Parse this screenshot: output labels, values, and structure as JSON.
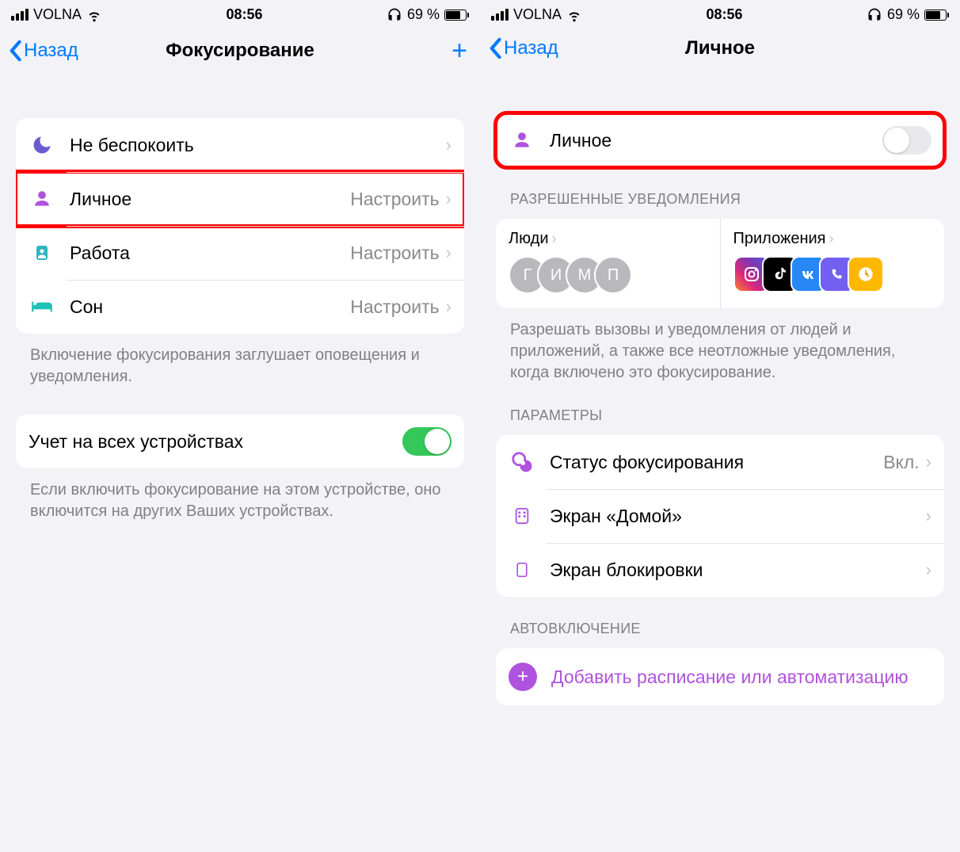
{
  "status": {
    "carrier": "VOLNA",
    "time": "08:56",
    "battery_pct": "69 %"
  },
  "left": {
    "nav": {
      "back": "Назад",
      "title": "Фокусирование"
    },
    "focus_modes": [
      {
        "label": "Не беспокоить",
        "detail": ""
      },
      {
        "label": "Личное",
        "detail": "Настроить"
      },
      {
        "label": "Работа",
        "detail": "Настроить"
      },
      {
        "label": "Сон",
        "detail": "Настроить"
      }
    ],
    "footer1": "Включение фокусирования заглушает оповещения и уведомления.",
    "share_row": {
      "label": "Учет на всех устройствах"
    },
    "footer2": "Если включить фокусирование на этом устройстве, оно включится на других Ваших устройствах."
  },
  "right": {
    "nav": {
      "back": "Назад",
      "title": "Личное"
    },
    "main_toggle": {
      "label": "Личное"
    },
    "allowed_header": "РАЗРЕШЕННЫЕ УВЕДОМЛЕНИЯ",
    "people": {
      "title": "Люди",
      "avatars": [
        "Г",
        "И",
        "М",
        "П"
      ]
    },
    "apps": {
      "title": "Приложения"
    },
    "allowed_footer": "Разрешать вызовы и уведомления от людей и приложений, а также все неотложные уведомления, когда включено это фокусирование.",
    "params_header": "ПАРАМЕТРЫ",
    "params": [
      {
        "label": "Статус фокусирования",
        "detail": "Вкл."
      },
      {
        "label": "Экран «Домой»",
        "detail": ""
      },
      {
        "label": "Экран блокировки",
        "detail": ""
      }
    ],
    "auto_header": "АВТОВКЛЮЧЕНИЕ",
    "add_schedule": "Добавить расписание или автоматизацию"
  }
}
